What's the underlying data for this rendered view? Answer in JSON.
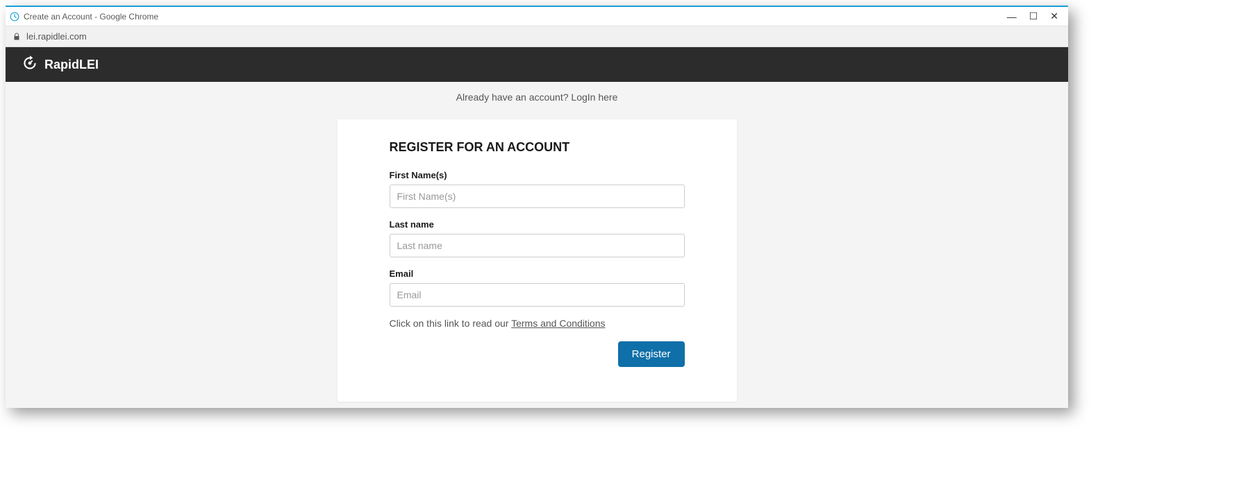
{
  "window": {
    "title": "Create an Account - Google Chrome",
    "url": "lei.rapidlei.com"
  },
  "brand": {
    "name": "RapidLEI"
  },
  "login_prompt": {
    "text": "Already have an account? ",
    "link": "LogIn here"
  },
  "form": {
    "title": "REGISTER FOR AN ACCOUNT",
    "first_name": {
      "label": "First Name(s)",
      "placeholder": "First Name(s)",
      "value": ""
    },
    "last_name": {
      "label": "Last name",
      "placeholder": "Last name",
      "value": ""
    },
    "email": {
      "label": "Email",
      "placeholder": "Email",
      "value": ""
    },
    "terms": {
      "prefix": "Click on this link to read our ",
      "link": "Terms and Conditions"
    },
    "submit_label": "Register"
  }
}
